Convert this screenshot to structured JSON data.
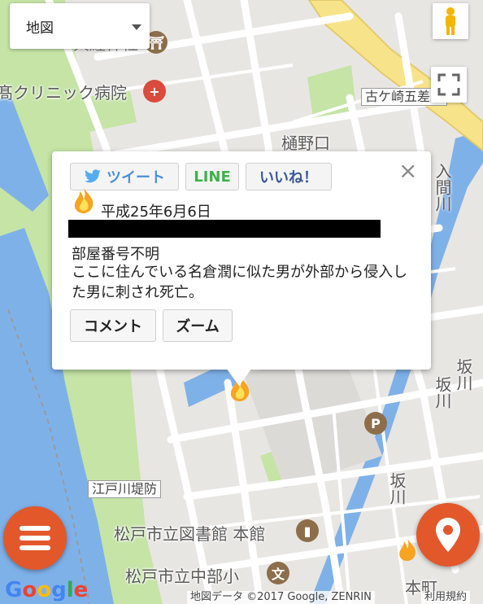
{
  "map_type": {
    "label": "地図"
  },
  "places": {
    "hospital": "髙クリニック病院",
    "hinoguchi": "樋野口",
    "koga_intersection": "古ケ崎五差路",
    "edogawa_embankment": "江戸川堤防",
    "library": "松戸市立図書館 本館",
    "junior_high": "松戸市立中部小",
    "sakagawa_1": "坂川",
    "sakagawa_2": "坂川",
    "sakagawa_3": "坂川",
    "honmachi": "本町",
    "river_vertical": "入間川",
    "truncated_top": "大経神社"
  },
  "popup": {
    "share": {
      "tweet": "ツイート",
      "line": "LINE",
      "like": "いいね！"
    },
    "close": "×",
    "date": "平成25年6月6日",
    "room": "部屋番号不明",
    "description": "ここに住んでいる名倉潤に似た男が外部から侵入した男に刺され死亡。",
    "buttons": {
      "comment": "コメント",
      "zoom": "ズーム"
    }
  },
  "attribution": {
    "google": "Google",
    "data": "地図データ ©2017 Google, ZENRIN",
    "terms": "利用規約"
  },
  "colors": {
    "accent": "#e2582a",
    "water": "#7fb1e9",
    "park": "#c5e4a5",
    "road": "#ffffff",
    "highway": "#f7e48a"
  },
  "icons": [
    "menu-icon",
    "location-pin-icon",
    "pegman-icon",
    "fullscreen-icon",
    "fire-icon",
    "twitter-bird-icon"
  ]
}
